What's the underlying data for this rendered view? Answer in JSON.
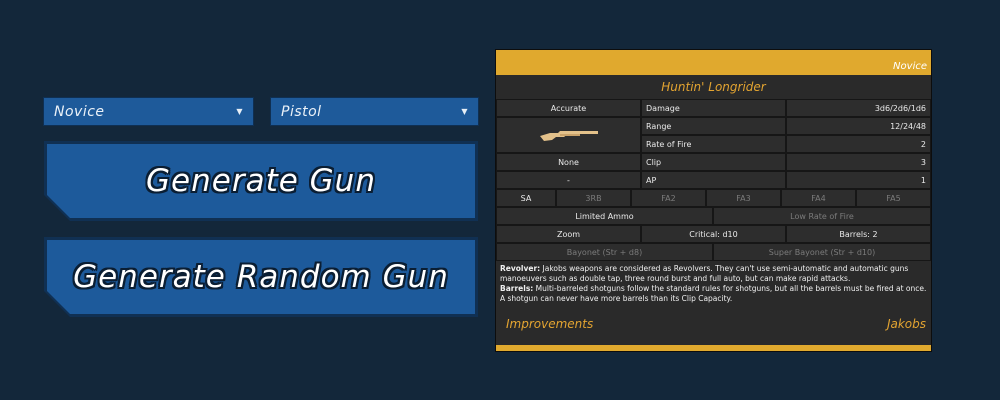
{
  "controls": {
    "level_select": "Novice",
    "type_select": "Pistol",
    "generate_label": "Generate Gun",
    "random_label": "Generate Random Gun"
  },
  "card": {
    "level": "Novice",
    "name": "Huntin' Longrider",
    "accuracy": "Accurate",
    "stats": [
      {
        "label": "Damage",
        "value": "3d6/2d6/1d6"
      },
      {
        "label": "Range",
        "value": "12/24/48"
      },
      {
        "label": "Rate of Fire",
        "value": "2"
      },
      {
        "label": "Clip",
        "value": "3"
      },
      {
        "label": "AP",
        "value": "1"
      }
    ],
    "element": "None",
    "ap_left": "-",
    "fire_modes": [
      "SA",
      "3RB",
      "FA2",
      "FA3",
      "FA4",
      "FA5"
    ],
    "fire_modes_active": [
      true,
      false,
      false,
      false,
      false,
      false
    ],
    "traits": [
      {
        "text": "Limited Ammo",
        "active": true
      },
      {
        "text": "Low Rate of Fire",
        "active": false
      }
    ],
    "extras": [
      {
        "text": "Zoom",
        "active": true
      },
      {
        "text": "Critical: d10",
        "active": true
      },
      {
        "text": "Barrels: 2",
        "active": true
      }
    ],
    "bayonets": [
      {
        "text": "Bayonet (Str + d8)",
        "active": false
      },
      {
        "text": "Super Bayonet (Str + d10)",
        "active": false
      }
    ],
    "desc": [
      {
        "label": "Revolver:",
        "text": " Jakobs weapons are considered as Revolvers. They can't use semi-automatic and automatic guns manoeuvers such as double tap, three round burst and full auto, but can make rapid attacks."
      },
      {
        "label": "Barrels:",
        "text": " Multi-barreled shotguns follow the standard rules for shotguns, but all the barrels must be fired at once. A shotgun can never have more barrels than its Clip Capacity."
      }
    ],
    "footer_left": "Improvements",
    "footer_right": "Jakobs",
    "colors": {
      "accent": "#e0a92e",
      "button": "#1d5a9b",
      "bg": "#13273a"
    },
    "gun_icon": "shotgun-icon"
  }
}
